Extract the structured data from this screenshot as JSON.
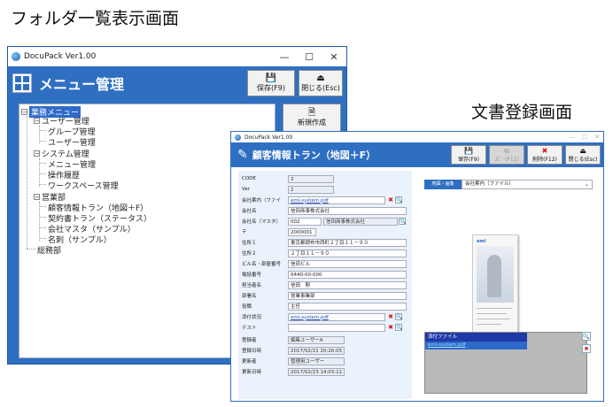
{
  "captions": {
    "folder_view": "フォルダ一覧表示画面",
    "doc_register": "文書登録画面"
  },
  "window1": {
    "titlebar": "DocuPack Ver1.00",
    "controls": [
      "—",
      "☐",
      "✕"
    ],
    "title": "メニュー管理",
    "save_label": "保存(F9)",
    "close_label": "閉じる(Esc)",
    "new_label": "新規作成",
    "tree": {
      "root": "業務メニュー",
      "user_mgmt": "ユーザー管理",
      "group_mgmt": "グループ管理",
      "user_mgmt_child": "ユーザー管理",
      "system_mgmt": "システム管理",
      "menu_mgmt": "メニュー管理",
      "op_history": "操作履歴",
      "workspace_mgmt": "ワークスペース管理",
      "sales": "営業部",
      "customer_info": "顧客情報トラン（地図＋F）",
      "contract": "契約書トラン（ステータス）",
      "company_master": "会社マスタ（サンプル）",
      "business_card": "名刺（サンプル）",
      "general_affairs": "総務部"
    }
  },
  "window2": {
    "titlebar": "DocuPack Ver1.00",
    "controls": [
      "—",
      "☐",
      "✕"
    ],
    "title": "顧客情報トラン（地図＋F）",
    "buttons": {
      "save": "保存(F9)",
      "copy": "ｺﾋﾟｰ(F11)",
      "delete": "削除(F12)",
      "close": "閉じる(Esc)"
    },
    "form": {
      "code_label": "CODE",
      "code_value": "2",
      "ver_label": "Ver",
      "ver_value": "2",
      "company_file_label": "会社案内（ファイ",
      "company_file_value": "emi-system.pdf",
      "company_name_label": "会社名",
      "company_name_value": "信田商事株式会社",
      "company_master_label": "会社名（マスタ）",
      "company_master_code": "002",
      "company_master_name": "信田商事株式会社",
      "zip_label": "〒",
      "zip_value": "2000001",
      "addr1_label": "住所１",
      "addr1_value": "東京都調布市西町２丁目１１－９０",
      "addr2_label": "住所２",
      "addr2_value": "２丁目１１－９０",
      "building_label": "ビル名・部屋番号",
      "building_value": "信田ビル",
      "phone_label": "電話番号",
      "phone_value": "0440-00-000",
      "person_label": "担当者名",
      "person_value": "信田　剛",
      "dept_label": "部署名",
      "dept_value": "営業事業部",
      "position_label": "役職",
      "position_value": "主任",
      "attachment_label": "添付状況",
      "attachment_value": "emi-system.pdf",
      "test_label": "テスト",
      "test_value": "",
      "creator_label": "登録者",
      "creator_value": "編集ユーザーA",
      "created_label": "登録日時",
      "created_value": "2017/02/21 20:26:05",
      "updater_label": "更新者",
      "updater_value": "管理用ユーザー",
      "updated_label": "更新日時",
      "updated_value": "2017/02/23 14:03:11"
    },
    "right": {
      "tab_label": "地図・画像",
      "select_value": "会社案内（ファイル）",
      "preview_brand": "emi",
      "attach_header": "添付ファイル",
      "attach_file": "emi-system.pdf"
    }
  },
  "colors": {
    "accent": "#2f6fc2",
    "selection": "#2e6ac9",
    "delete_red": "#dd1111"
  }
}
